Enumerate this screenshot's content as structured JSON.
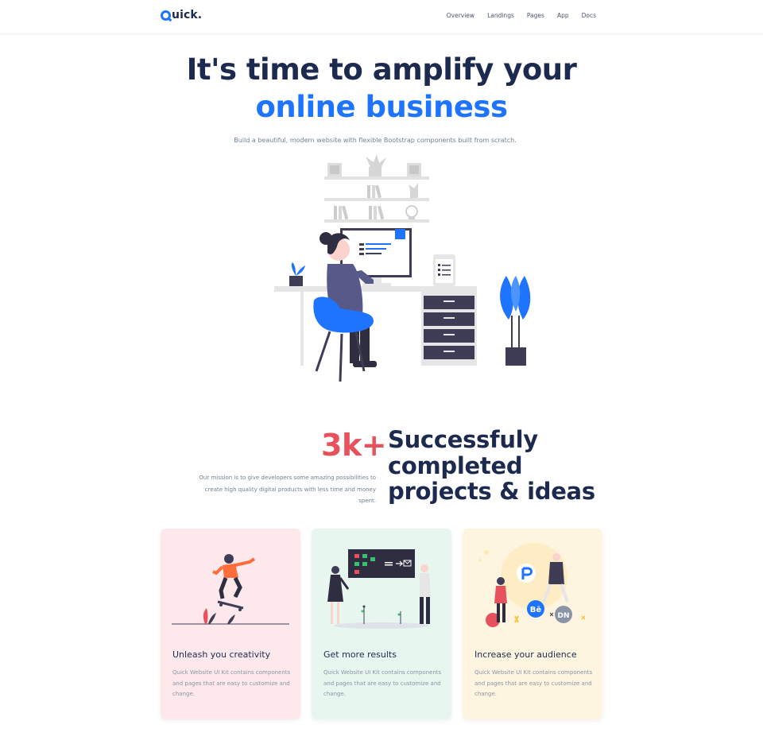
{
  "brand": {
    "name": "uick."
  },
  "nav": {
    "items": [
      "Overview",
      "Landings",
      "Pages",
      "App",
      "Docs"
    ]
  },
  "hero": {
    "title_line1": "It's time to amplify your",
    "title_line2": "online business",
    "subtitle": "Build a beautiful, modern website with flexible Bootstrap components built from scratch."
  },
  "stats": {
    "mission": "Our mission is to give developers some amazing possibilities to create high quality digital products with less time and money spent.",
    "number": "3k+",
    "headline_line1": "Successfuly",
    "headline_line2": "completed",
    "headline_line3": "projects & ideas"
  },
  "cards": [
    {
      "title": "Unleash you creativity",
      "description": "Quick Website UI Kit contains components and pages that are easy to customize and change.",
      "bg": "#fde9eb"
    },
    {
      "title": "Get more results",
      "description": "Quick Website UI Kit contains components and pages that are easy to customize and change.",
      "bg": "#e8f6f0"
    },
    {
      "title": "Increase your audience",
      "description": "Quick Website UI Kit contains components and pages that are easy to customize and change.",
      "bg": "#fef5e0"
    }
  ],
  "colors": {
    "primary": "#1e74ff",
    "dark": "#1b2a4e",
    "accent": "#e8505b",
    "muted": "#718096"
  }
}
